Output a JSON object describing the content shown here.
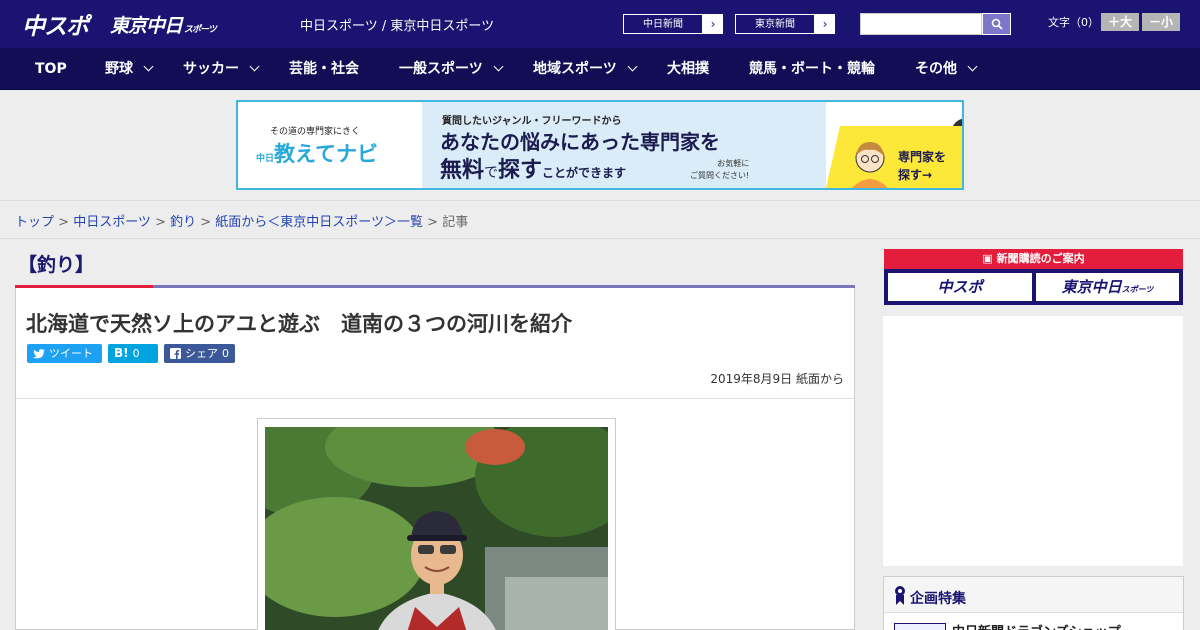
{
  "header": {
    "logo_chuspo": "中スポ",
    "logo_tokyo": "東京中日",
    "logo_tokyo_sub": "スポーツ",
    "site_names": "中日スポーツ / 東京中日スポーツ",
    "chunichi_btn": "中日新聞",
    "tokyo_btn": "東京新聞",
    "font_size_label": "文字（0）",
    "font_up": "＋大",
    "font_down": "－小"
  },
  "nav": {
    "items": [
      "TOP",
      "野球",
      "サッカー",
      "芸能・社会",
      "一般スポーツ",
      "地域スポーツ",
      "大相撲",
      "競馬・ボート・競輪",
      "その他"
    ]
  },
  "banner": {
    "tag": "その道の専門家にきく",
    "brand": "教えてナビ",
    "brand_prefix": "中日",
    "line1": "質問したいジャンル・フリーワードから",
    "line2": "あなたの悩みにあった専門家を",
    "line3a": "無料",
    "line3b": "で",
    "line3c": "探す",
    "line3d": "ことができます",
    "note1": "お気軽に",
    "note2": "ご質問ください!",
    "cta1": "専門家を",
    "cta2": "探す→"
  },
  "breadcrumb": {
    "items": [
      "トップ",
      "中日スポーツ",
      "釣り",
      "紙面から＜東京中日スポーツ＞一覧"
    ],
    "current": "記事"
  },
  "article": {
    "category": "【釣り】",
    "title": "北海道で天然ソ上のアユと遊ぶ　道南の３つの河川を紹介",
    "tweet": "ツイート",
    "hatena": "B!",
    "hatena_count": "0",
    "share": "シェア",
    "share_count": "0",
    "date": "2019年8月9日 紙面から"
  },
  "sidebar": {
    "subscribe_head": "新聞購読のご案内",
    "sub_chuspo": "中スポ",
    "sub_tokyo": "東京中日",
    "sub_tokyo_small": "スポーツ",
    "feature_title": "企画特集",
    "feature_item": "中日新聞ドラゴンズショップ"
  },
  "colors": {
    "header_bg": "#1a1371",
    "nav_bg": "#120d55",
    "accent_red": "#e21e3c",
    "twitter": "#1da1f2",
    "hatena": "#00a4de",
    "facebook": "#3b5998"
  }
}
